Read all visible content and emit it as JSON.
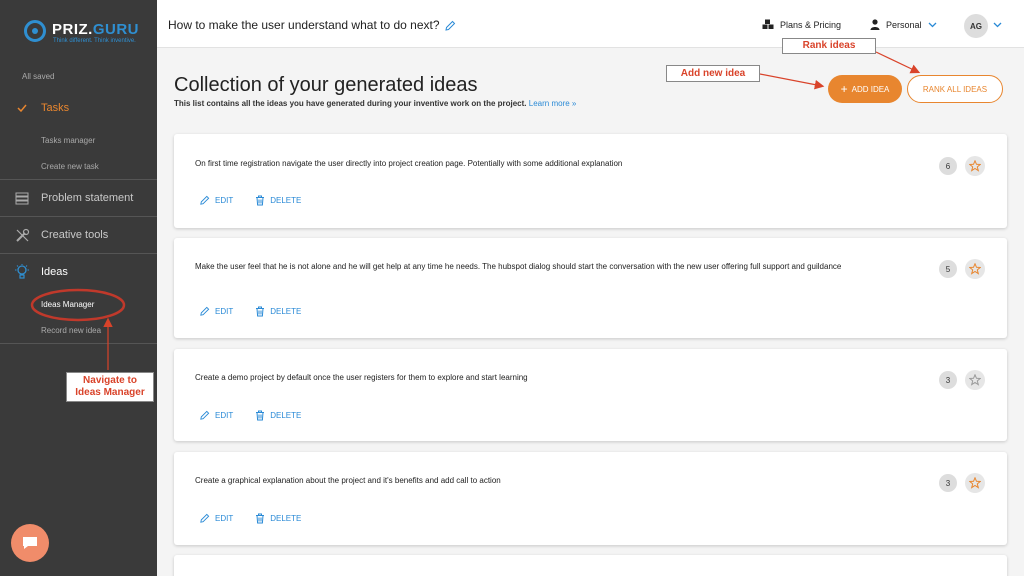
{
  "sidebar": {
    "brand_a": "PRIZ.",
    "brand_b": "GURU",
    "tagline": "Think different. Think inventive.",
    "saved_status": "All saved",
    "tasks": {
      "label": "Tasks",
      "sub": [
        "Tasks manager",
        "Create new task"
      ]
    },
    "problem": {
      "label": "Problem statement"
    },
    "creative": {
      "label": "Creative tools"
    },
    "ideas": {
      "label": "Ideas",
      "sub": [
        "Ideas Manager",
        "Record new idea"
      ]
    }
  },
  "header": {
    "project_title": "How to make the user understand what to do next?",
    "plans_label": "Plans & Pricing",
    "account_label": "Personal",
    "avatar_initials": "AG"
  },
  "main": {
    "title": "Collection of your generated ideas",
    "subtitle": "This list contains all the ideas you have generated during your inventive work on the project.",
    "learn_more": "Learn more »",
    "add_idea_label": "ADD IDEA",
    "rank_all_label": "RANK ALL IDEAS",
    "edit_label": "EDIT",
    "delete_label": "DELETE",
    "ideas": [
      {
        "text": "On first time registration navigate the user directly into project creation page. Potentially with some additional explanation",
        "rank": "6",
        "starred": true
      },
      {
        "text": "Make the user feel that he is not alone and he will get help at any time he needs. The hubspot dialog should start the conversation with the new user offering full support and guildance",
        "rank": "5",
        "starred": true
      },
      {
        "text": "Create a demo project by default once the user registers for them to explore and start learning",
        "rank": "3",
        "starred": false
      },
      {
        "text": "Create a graphical explanation about the project and it's benefits and add call to action",
        "rank": "3",
        "starred": true
      }
    ]
  },
  "annotations": {
    "rank_ideas": "Rank ideas",
    "add_new_idea": "Add new idea",
    "navigate_line1": "Navigate to",
    "navigate_line2": "Ideas Manager"
  },
  "colors": {
    "accent_orange": "#e8862f",
    "link_blue": "#2a8ad6",
    "annotation_red": "#d9432a",
    "sidebar_bg": "#3a3a3a"
  }
}
